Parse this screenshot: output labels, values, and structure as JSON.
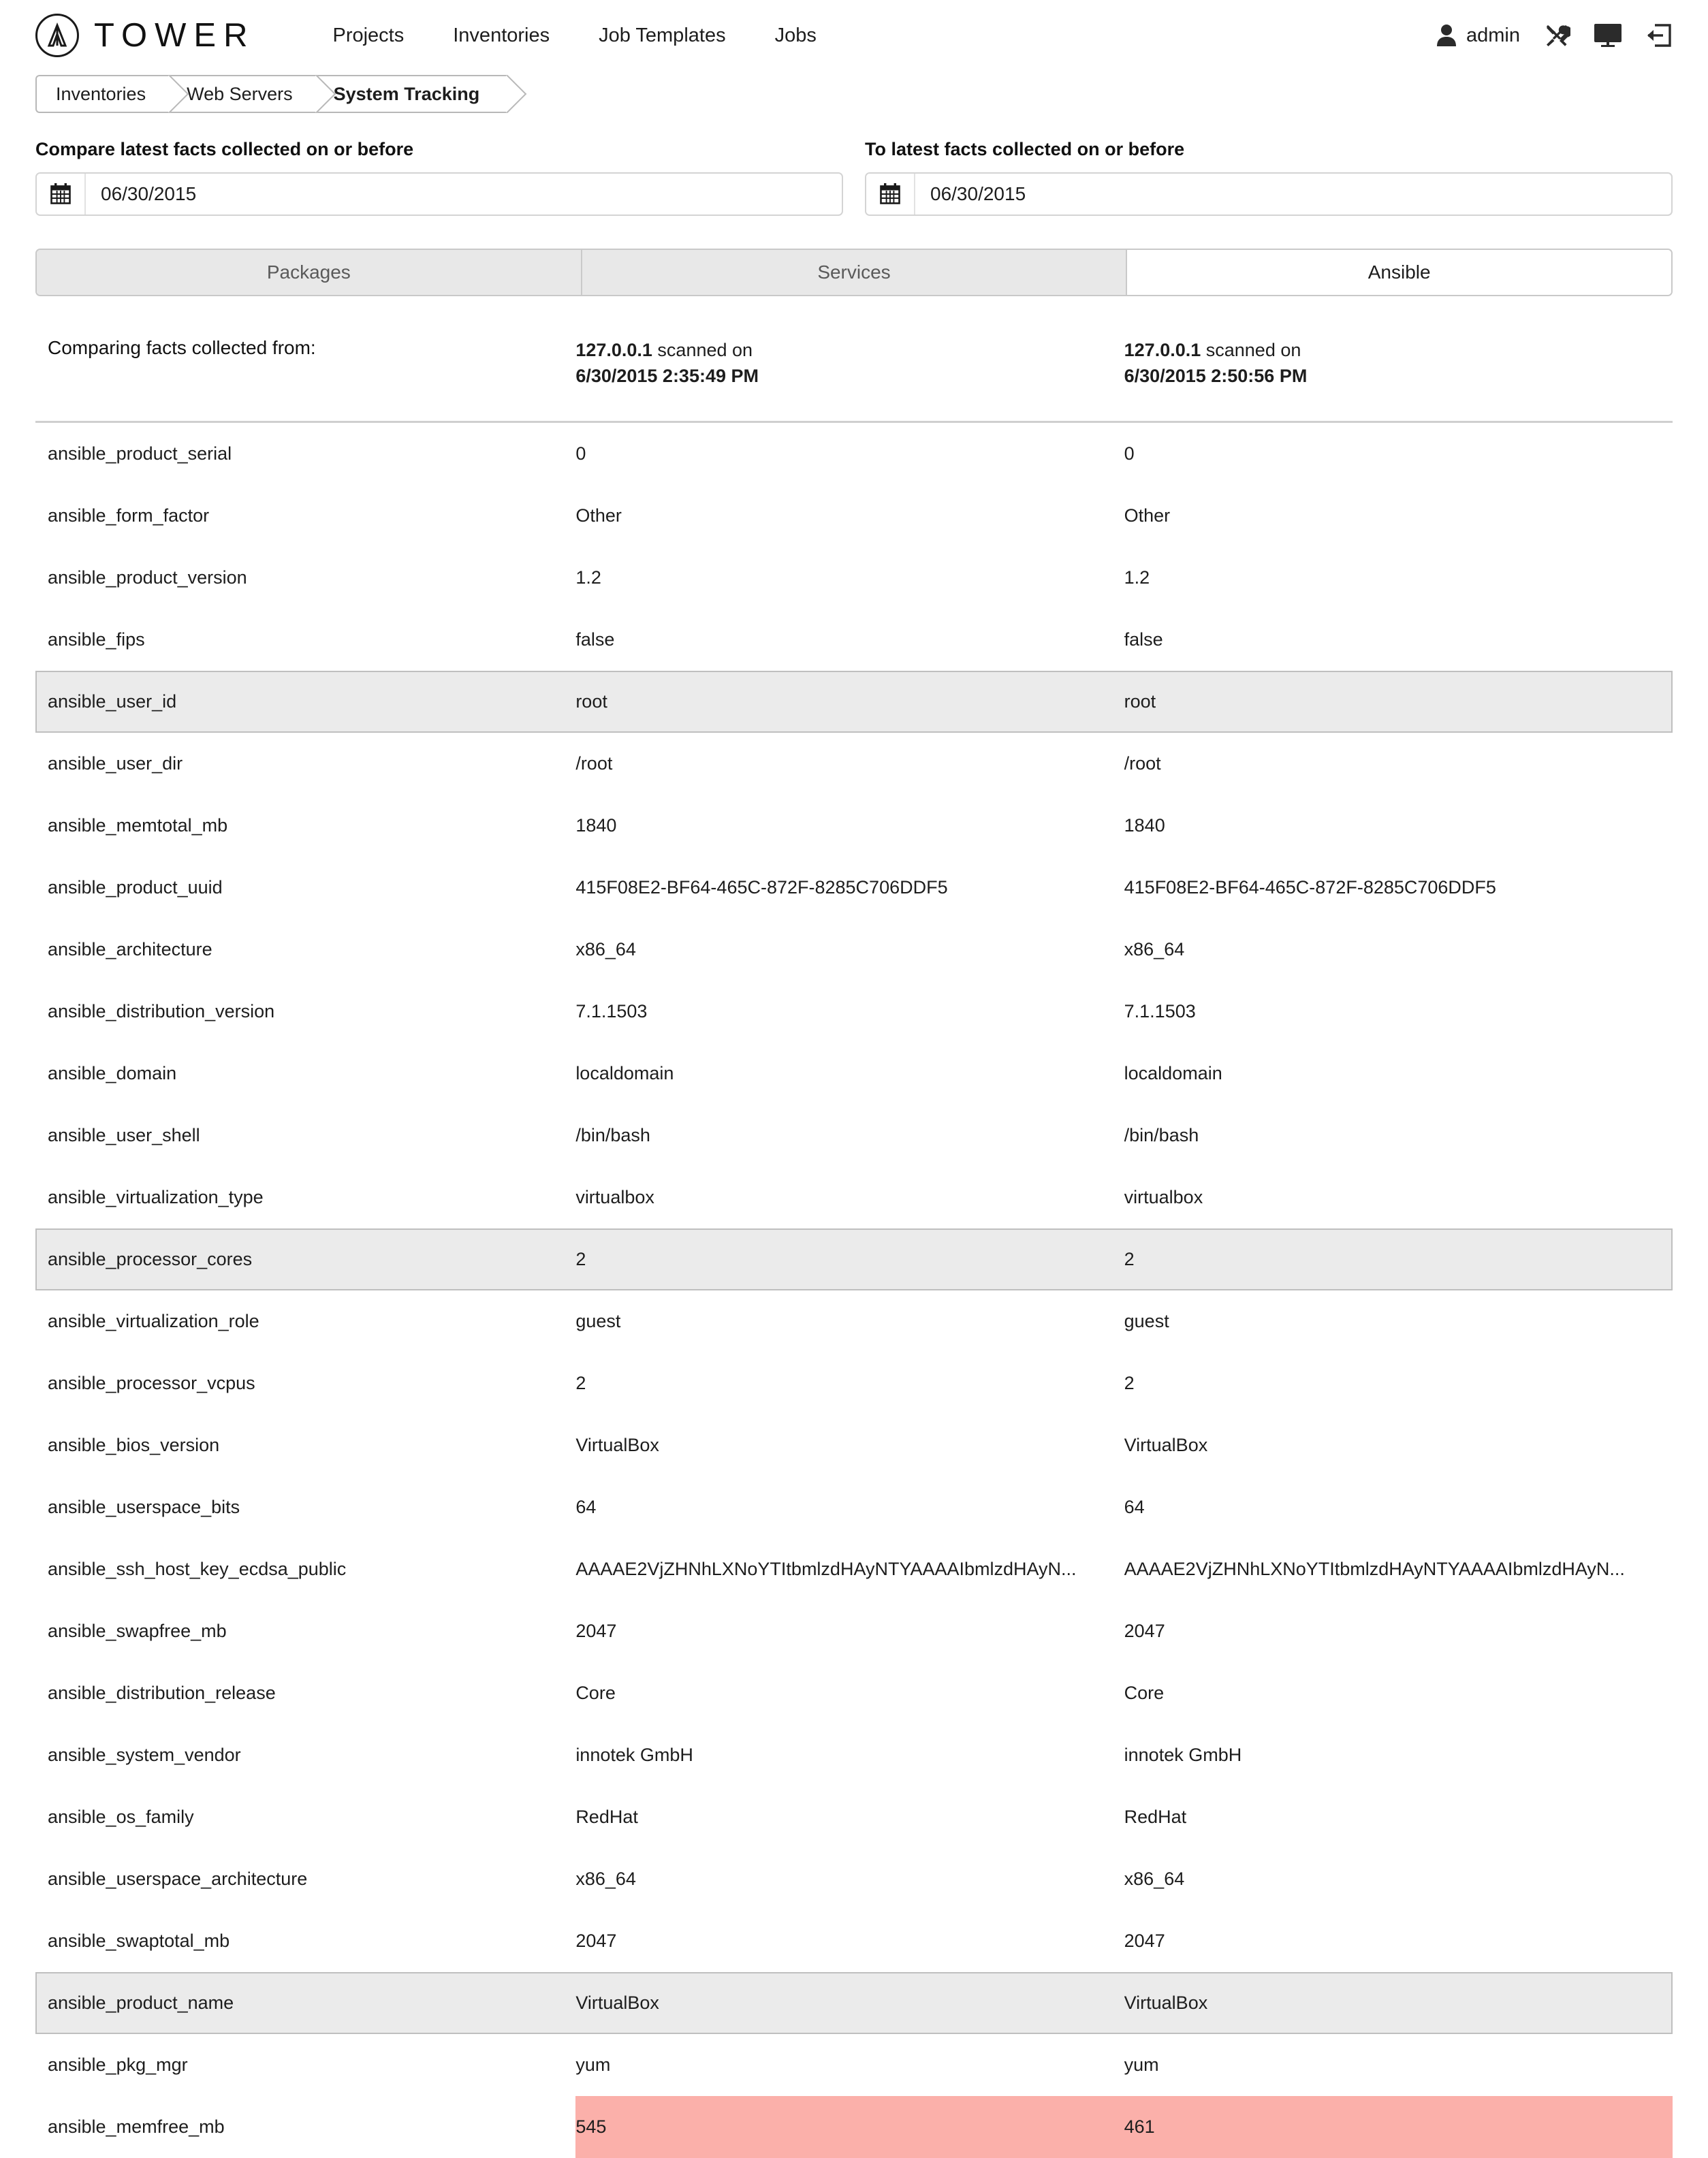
{
  "nav": {
    "brand": "TOWER",
    "links": [
      "Projects",
      "Inventories",
      "Job Templates",
      "Jobs"
    ],
    "user": "admin",
    "icons": [
      "user-icon",
      "tools-icon",
      "monitor-icon",
      "logout-icon"
    ]
  },
  "breadcrumb": {
    "items": [
      {
        "label": "Inventories",
        "current": false
      },
      {
        "label": "Web Servers",
        "current": false
      },
      {
        "label": "System Tracking",
        "current": true
      }
    ]
  },
  "filters": {
    "left": {
      "label": "Compare latest facts collected on or before",
      "value": "06/30/2015",
      "placeholder": "MM/DD/YYYY",
      "icon": "calendar-icon"
    },
    "right": {
      "label": "To latest facts collected on or before",
      "value": "06/30/2015",
      "placeholder": "MM/DD/YYYY",
      "icon": "calendar-icon"
    }
  },
  "tabs": [
    {
      "label": "Packages",
      "active": false
    },
    {
      "label": "Services",
      "active": false
    },
    {
      "label": "Ansible",
      "active": true
    }
  ],
  "table": {
    "key_header": "Comparing facts collected from:",
    "left_header": {
      "host": "127.0.0.1",
      "scanned_on": " scanned on",
      "timestamp": "6/30/2015 2:35:49 PM"
    },
    "right_header": {
      "host": "127.0.0.1",
      "scanned_on": " scanned on",
      "timestamp": "6/30/2015 2:50:56 PM"
    },
    "diff_color": "#fbb0aa",
    "shaded_color": "#ebebeb",
    "rows": [
      {
        "key": "ansible_product_serial",
        "left": "0",
        "right": "0",
        "shaded": false,
        "diff": false
      },
      {
        "key": "ansible_form_factor",
        "left": "Other",
        "right": "Other",
        "shaded": false,
        "diff": false
      },
      {
        "key": "ansible_product_version",
        "left": "1.2",
        "right": "1.2",
        "shaded": false,
        "diff": false
      },
      {
        "key": "ansible_fips",
        "left": "false",
        "right": "false",
        "shaded": false,
        "diff": false
      },
      {
        "key": "ansible_user_id",
        "left": "root",
        "right": "root",
        "shaded": true,
        "diff": false
      },
      {
        "key": "ansible_user_dir",
        "left": "/root",
        "right": "/root",
        "shaded": false,
        "diff": false
      },
      {
        "key": "ansible_memtotal_mb",
        "left": "1840",
        "right": "1840",
        "shaded": false,
        "diff": false
      },
      {
        "key": "ansible_product_uuid",
        "left": "415F08E2-BF64-465C-872F-8285C706DDF5",
        "right": "415F08E2-BF64-465C-872F-8285C706DDF5",
        "shaded": false,
        "diff": false
      },
      {
        "key": "ansible_architecture",
        "left": "x86_64",
        "right": "x86_64",
        "shaded": false,
        "diff": false
      },
      {
        "key": "ansible_distribution_version",
        "left": "7.1.1503",
        "right": "7.1.1503",
        "shaded": false,
        "diff": false
      },
      {
        "key": "ansible_domain",
        "left": "localdomain",
        "right": "localdomain",
        "shaded": false,
        "diff": false
      },
      {
        "key": "ansible_user_shell",
        "left": "/bin/bash",
        "right": "/bin/bash",
        "shaded": false,
        "diff": false
      },
      {
        "key": "ansible_virtualization_type",
        "left": "virtualbox",
        "right": "virtualbox",
        "shaded": false,
        "diff": false
      },
      {
        "key": "ansible_processor_cores",
        "left": "2",
        "right": "2",
        "shaded": true,
        "diff": false
      },
      {
        "key": "ansible_virtualization_role",
        "left": "guest",
        "right": "guest",
        "shaded": false,
        "diff": false
      },
      {
        "key": "ansible_processor_vcpus",
        "left": "2",
        "right": "2",
        "shaded": false,
        "diff": false
      },
      {
        "key": "ansible_bios_version",
        "left": "VirtualBox",
        "right": "VirtualBox",
        "shaded": false,
        "diff": false
      },
      {
        "key": "ansible_userspace_bits",
        "left": "64",
        "right": "64",
        "shaded": false,
        "diff": false
      },
      {
        "key": "ansible_ssh_host_key_ecdsa_public",
        "left": "AAAAE2VjZHNhLXNoYTItbmlzdHAyNTYAAAAIbmlzdHAyN...",
        "right": "AAAAE2VjZHNhLXNoYTItbmlzdHAyNTYAAAAIbmlzdHAyN...",
        "shaded": false,
        "diff": false
      },
      {
        "key": "ansible_swapfree_mb",
        "left": "2047",
        "right": "2047",
        "shaded": false,
        "diff": false
      },
      {
        "key": "ansible_distribution_release",
        "left": "Core",
        "right": "Core",
        "shaded": false,
        "diff": false
      },
      {
        "key": "ansible_system_vendor",
        "left": "innotek GmbH",
        "right": "innotek GmbH",
        "shaded": false,
        "diff": false
      },
      {
        "key": "ansible_os_family",
        "left": "RedHat",
        "right": "RedHat",
        "shaded": false,
        "diff": false
      },
      {
        "key": "ansible_userspace_architecture",
        "left": "x86_64",
        "right": "x86_64",
        "shaded": false,
        "diff": false
      },
      {
        "key": "ansible_swaptotal_mb",
        "left": "2047",
        "right": "2047",
        "shaded": false,
        "diff": false
      },
      {
        "key": "ansible_product_name",
        "left": "VirtualBox",
        "right": "VirtualBox",
        "shaded": true,
        "diff": false
      },
      {
        "key": "ansible_pkg_mgr",
        "left": "yum",
        "right": "yum",
        "shaded": false,
        "diff": false
      },
      {
        "key": "ansible_memfree_mb",
        "left": "545",
        "right": "461",
        "shaded": false,
        "diff": true
      }
    ]
  }
}
